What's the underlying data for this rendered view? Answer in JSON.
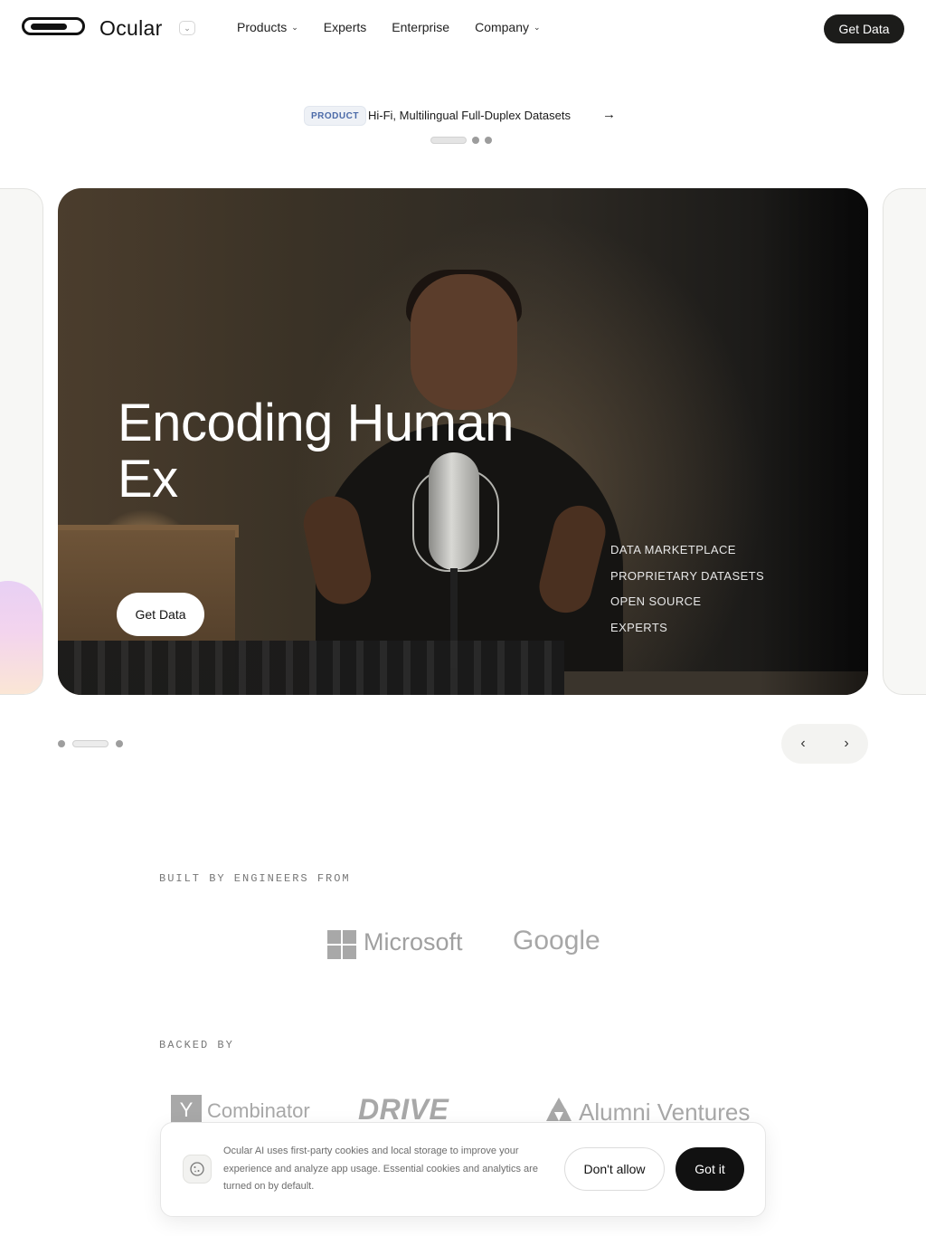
{
  "header": {
    "brand": "Ocular",
    "nav": [
      {
        "label": "Products",
        "has_dropdown": true
      },
      {
        "label": "Experts",
        "has_dropdown": false
      },
      {
        "label": "Enterprise",
        "has_dropdown": false
      },
      {
        "label": "Company",
        "has_dropdown": true
      }
    ],
    "cta": "Get Data"
  },
  "announcement": {
    "tag": "PRODUCT",
    "text": "Hi-Fi, Multilingual Full-Duplex Datasets",
    "arrow_icon": "arrow-right-icon"
  },
  "hero": {
    "title": "Encoding Human\nEx",
    "cta": "Get Data",
    "links": [
      "DATA MARKETPLACE",
      "PROPRIETARY DATASETS",
      "OPEN SOURCE",
      "EXPERTS"
    ]
  },
  "carousel": {
    "prev_icon": "‹",
    "next_icon": "›"
  },
  "engineers": {
    "label": "BUILT BY ENGINEERS FROM",
    "logos": [
      "Microsoft",
      "Google"
    ]
  },
  "backers": {
    "label": "BACKED BY",
    "logos": [
      "Y",
      "Combinator",
      "DRIVE",
      "Alumni Ventures"
    ]
  },
  "cookie_banner": {
    "text": "Ocular AI uses first-party cookies and local storage to improve your experience and analyze app usage. Essential cookies and analytics are turned on by default.",
    "decline": "Don't allow",
    "accept": "Got it"
  },
  "colors": {
    "accent_dark": "#1c1c1a",
    "tag_text": "#4b6aa8",
    "logo_gray": "#a8a8a8"
  }
}
